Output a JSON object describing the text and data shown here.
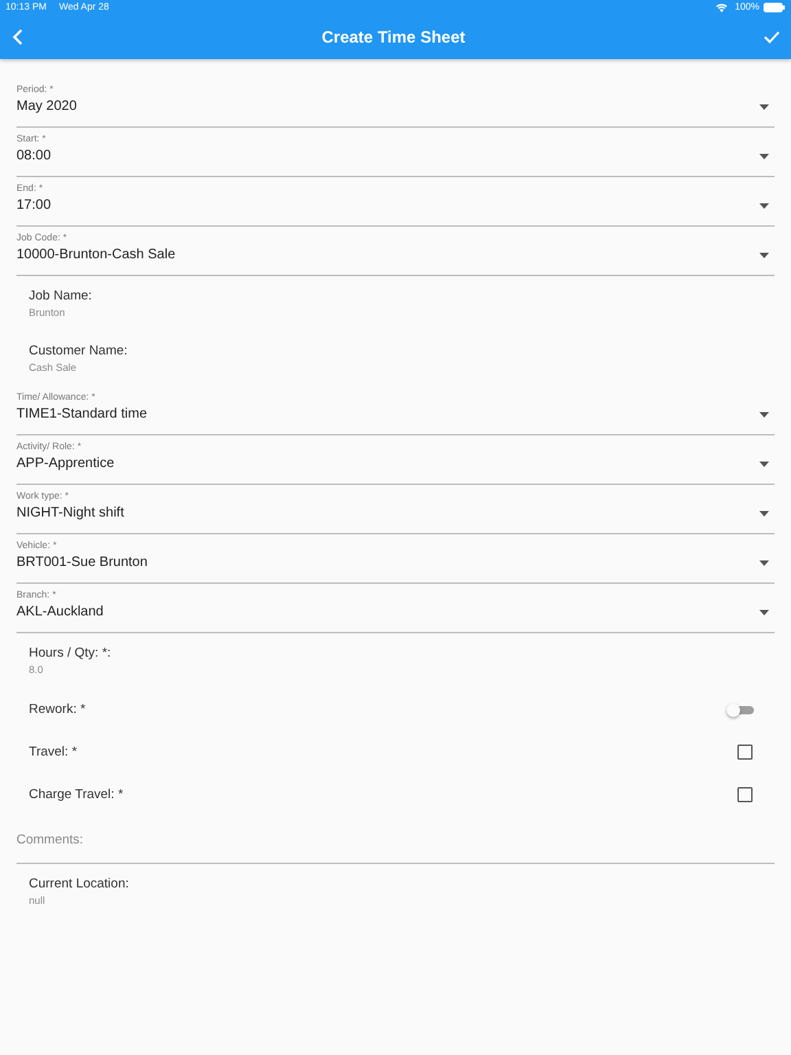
{
  "status_bar": {
    "time": "10:13 PM",
    "date": "Wed Apr 28",
    "battery": "100%"
  },
  "app_bar": {
    "title": "Create Time Sheet"
  },
  "fields": [
    {
      "kind": "dropdown",
      "label": "Period: *",
      "value": "May 2020"
    },
    {
      "kind": "dropdown",
      "label": "Start: *",
      "value": "08:00"
    },
    {
      "kind": "dropdown",
      "label": "End: *",
      "value": "17:00"
    },
    {
      "kind": "dropdown",
      "label": "Job Code: *",
      "value": "10000-Brunton-Cash Sale"
    },
    {
      "kind": "info",
      "label": "Job Name:",
      "value": "Brunton"
    },
    {
      "kind": "info",
      "label": "Customer Name:",
      "value": "Cash Sale"
    },
    {
      "kind": "dropdown",
      "label": "Time/ Allowance: *",
      "value": "TIME1-Standard time"
    },
    {
      "kind": "dropdown",
      "label": "Activity/ Role: *",
      "value": "APP-Apprentice"
    },
    {
      "kind": "dropdown",
      "label": "Work type: *",
      "value": "NIGHT-Night shift"
    },
    {
      "kind": "dropdown",
      "label": "Vehicle: *",
      "value": "BRT001-Sue Brunton"
    },
    {
      "kind": "dropdown",
      "label": "Branch: *",
      "value": "AKL-Auckland"
    },
    {
      "kind": "info",
      "label": "Hours / Qty: *:",
      "value": "8.0"
    },
    {
      "kind": "toggle",
      "label": "Rework: *",
      "on": false
    },
    {
      "kind": "checkbox",
      "label": "Travel: *",
      "checked": false
    },
    {
      "kind": "checkbox",
      "label": "Charge Travel: *",
      "checked": false
    },
    {
      "kind": "textarea",
      "placeholder": "Comments:"
    },
    {
      "kind": "info",
      "label": "Current Location:",
      "value": "null"
    }
  ]
}
